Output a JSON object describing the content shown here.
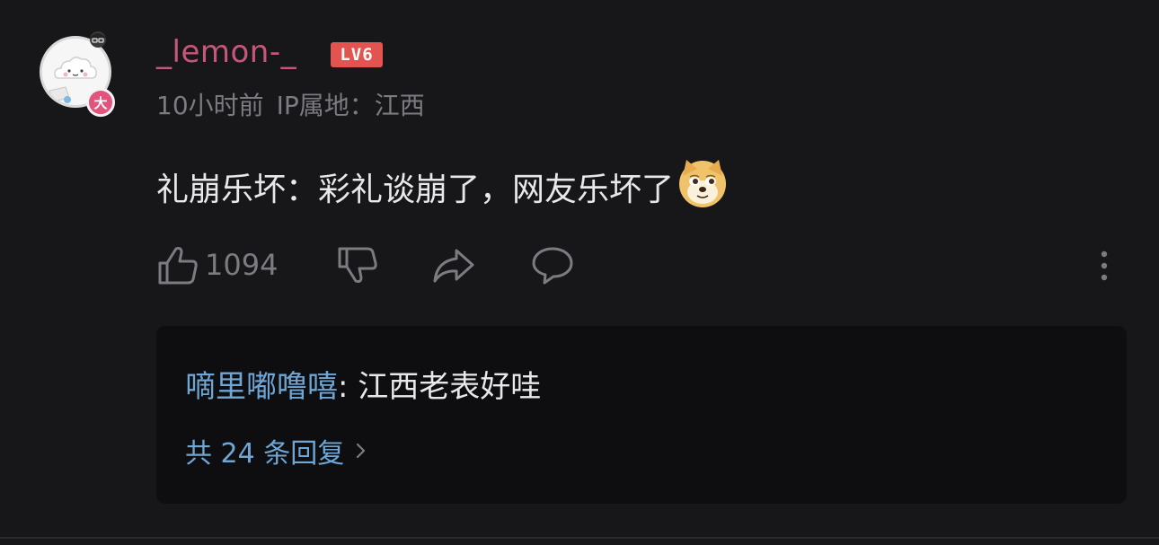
{
  "comment": {
    "username": "_lemon-_",
    "level_badge": "LV6",
    "avatar_badge": "大",
    "time": "10小时前",
    "ip_location": "IP属地：江西",
    "text": "礼崩乐坏：彩礼谈崩了，网友乐坏了",
    "emoji_icon": "doge-emoji-icon",
    "like_count": "1094"
  },
  "reply_panel": {
    "reply_user": "嘀里嘟噜嘻",
    "reply_text": ": 江西老表好哇",
    "total_label": "共 24 条回复"
  },
  "colors": {
    "background": "#17171a",
    "username": "#c5587a",
    "level_badge": "#e3534f",
    "link_blue": "#6ea6d6",
    "muted": "#7b7b80",
    "reply_bg": "#0e0e10"
  }
}
